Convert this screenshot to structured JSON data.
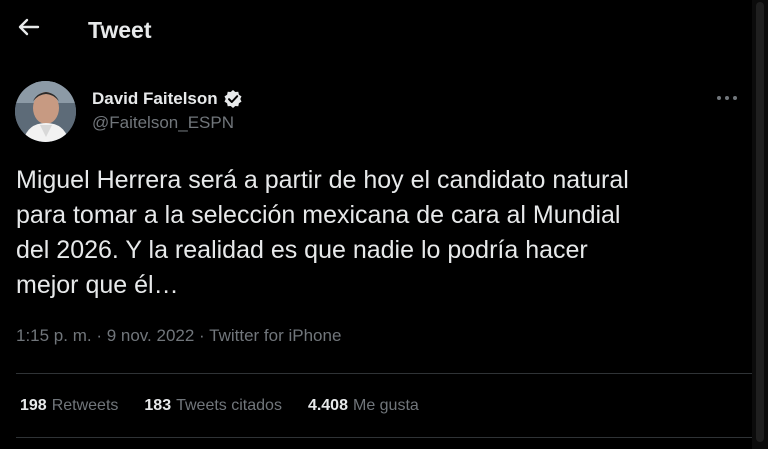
{
  "header": {
    "title": "Tweet",
    "back_icon": "arrow-left-icon"
  },
  "author": {
    "name": "David Faitelson",
    "handle": "@Faitelson_ESPN",
    "verified_icon": "verified-badge-icon"
  },
  "tweet": {
    "text": "Miguel Herrera será a partir de hoy el candidato natural\npara tomar a la selección mexicana de cara al Mundial\ndel 2026. Y la realidad es que nadie lo podría hacer\nmejor que él…"
  },
  "meta": {
    "time": "1:15 p. m.",
    "sep1": " · ",
    "date": "9 nov. 2022",
    "sep2": " · ",
    "client": "Twitter for iPhone"
  },
  "stats": {
    "retweets_count": "198",
    "retweets_label": "Retweets",
    "quotes_count": "183",
    "quotes_label": "Tweets citados",
    "likes_count": "4.408",
    "likes_label": "Me gusta"
  },
  "colors": {
    "background": "#000000",
    "text": "#e7e9ea",
    "secondary": "#71767b",
    "divider": "#2f3336"
  }
}
